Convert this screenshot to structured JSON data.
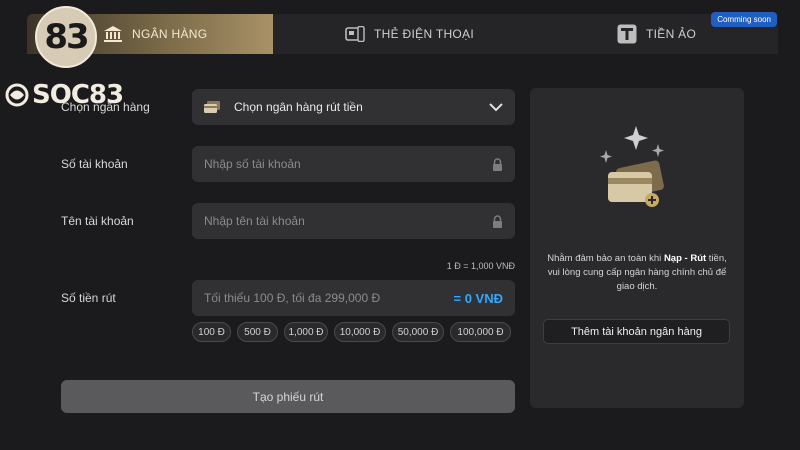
{
  "logo": {
    "badge_number": "83",
    "wordmark": "SOC83"
  },
  "tabs": {
    "bank": "NGÂN HÀNG",
    "phone_card": "THẺ ĐIỆN THOẠI",
    "crypto": "TIỀN ẢO",
    "crypto_badge": "Comming soon"
  },
  "form": {
    "bank_label": "Chọn ngân hàng",
    "bank_select_value": "Chọn ngân hàng rút tiền",
    "account_number_label": "Số tài khoản",
    "account_number_placeholder": "Nhập số tài khoản",
    "account_name_label": "Tên tài khoản",
    "account_name_placeholder": "Nhập tên tài khoản",
    "rate_text": "1 Đ = 1,000 VNĐ",
    "amount_label": "Số tiền rút",
    "amount_placeholder": "Tối thiểu 100 Đ, tối đa 299,000 Đ",
    "amount_converted": "= 0 VNĐ",
    "quick_amounts": [
      "100 Đ",
      "500 Đ",
      "1,000 Đ",
      "10,000 Đ",
      "50,000 Đ",
      "100,000 Đ"
    ],
    "submit_label": "Tạo phiếu rút"
  },
  "panel": {
    "text_before": "Nhằm đảm bảo an toàn khi ",
    "text_bold": "Nạp - Rút",
    "text_after": " tiền, vui lòng cung cấp ngân hàng chính chủ để giao dịch.",
    "add_bank_label": "Thêm tài khoản ngân hàng"
  },
  "colors": {
    "accent_gold": "#a89166",
    "accent_blue": "#2fa8ff",
    "badge_blue": "#1f5fc4"
  }
}
